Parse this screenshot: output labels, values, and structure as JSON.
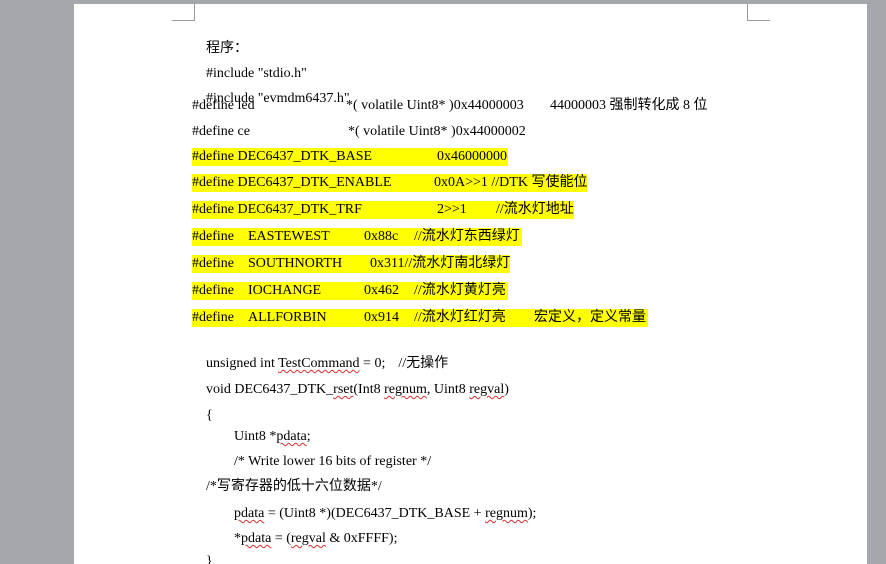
{
  "document": {
    "lines": [
      {
        "text": "程序："
      },
      {
        "text": "#include \"stdio.h\""
      },
      {
        "text": "#include \"evmdm6437.h\""
      },
      {
        "parts": [
          "#define led",
          "*( volatile Uint8* )0x44000003",
          "44000003 强制转化成 8 位"
        ]
      },
      {
        "parts": [
          "#define ce",
          "*( volatile Uint8* )0x44000002"
        ]
      },
      {
        "parts": [
          "#define DEC6437_DTK_BASE",
          "0x46000000"
        ]
      },
      {
        "parts": [
          "#define DEC6437_DTK_ENABLE",
          "0x0A>>1 //DTK 写使能位"
        ]
      },
      {
        "parts": [
          "#define DEC6437_DTK_TRF",
          "2>>1",
          "//流水灯地址"
        ]
      },
      {
        "parts": [
          "#define",
          "EASTEWEST",
          "0x88c",
          "//流水灯东西绿灯"
        ]
      },
      {
        "parts": [
          "#define",
          "SOUTHNORTH",
          "0x311//流水灯南北绿灯"
        ]
      },
      {
        "parts": [
          "#define",
          "IOCHANGE",
          "0x462",
          "//流水灯黄灯亮"
        ]
      },
      {
        "parts": [
          "#define",
          "ALLFORBIN",
          "0x914",
          "//流水灯红灯亮",
          "宏定义，定义常量"
        ]
      },
      {
        "parts": [
          "unsigned int ",
          "TestCommand",
          " = 0;",
          "//无操作"
        ]
      },
      {
        "parts": [
          "void DEC6437_DTK_",
          "rset",
          "(Int8 ",
          "regnum",
          ", Uint8 ",
          "regval",
          ")"
        ]
      },
      {
        "text": "{"
      },
      {
        "parts": [
          "Uint8 *",
          "pdata",
          ";"
        ]
      },
      {
        "text": "/* Write lower 16 bits of register */"
      },
      {
        "text": "/*写寄存器的低十六位数据*/"
      },
      {
        "parts": [
          "pdata",
          " = (Uint8 *)(DEC6437_DTK_BASE + ",
          "regnum",
          ");"
        ]
      },
      {
        "parts": [
          "*",
          "pdata",
          " = (",
          "regval",
          " & 0xFFFF);"
        ]
      },
      {
        "text": "}"
      }
    ]
  }
}
